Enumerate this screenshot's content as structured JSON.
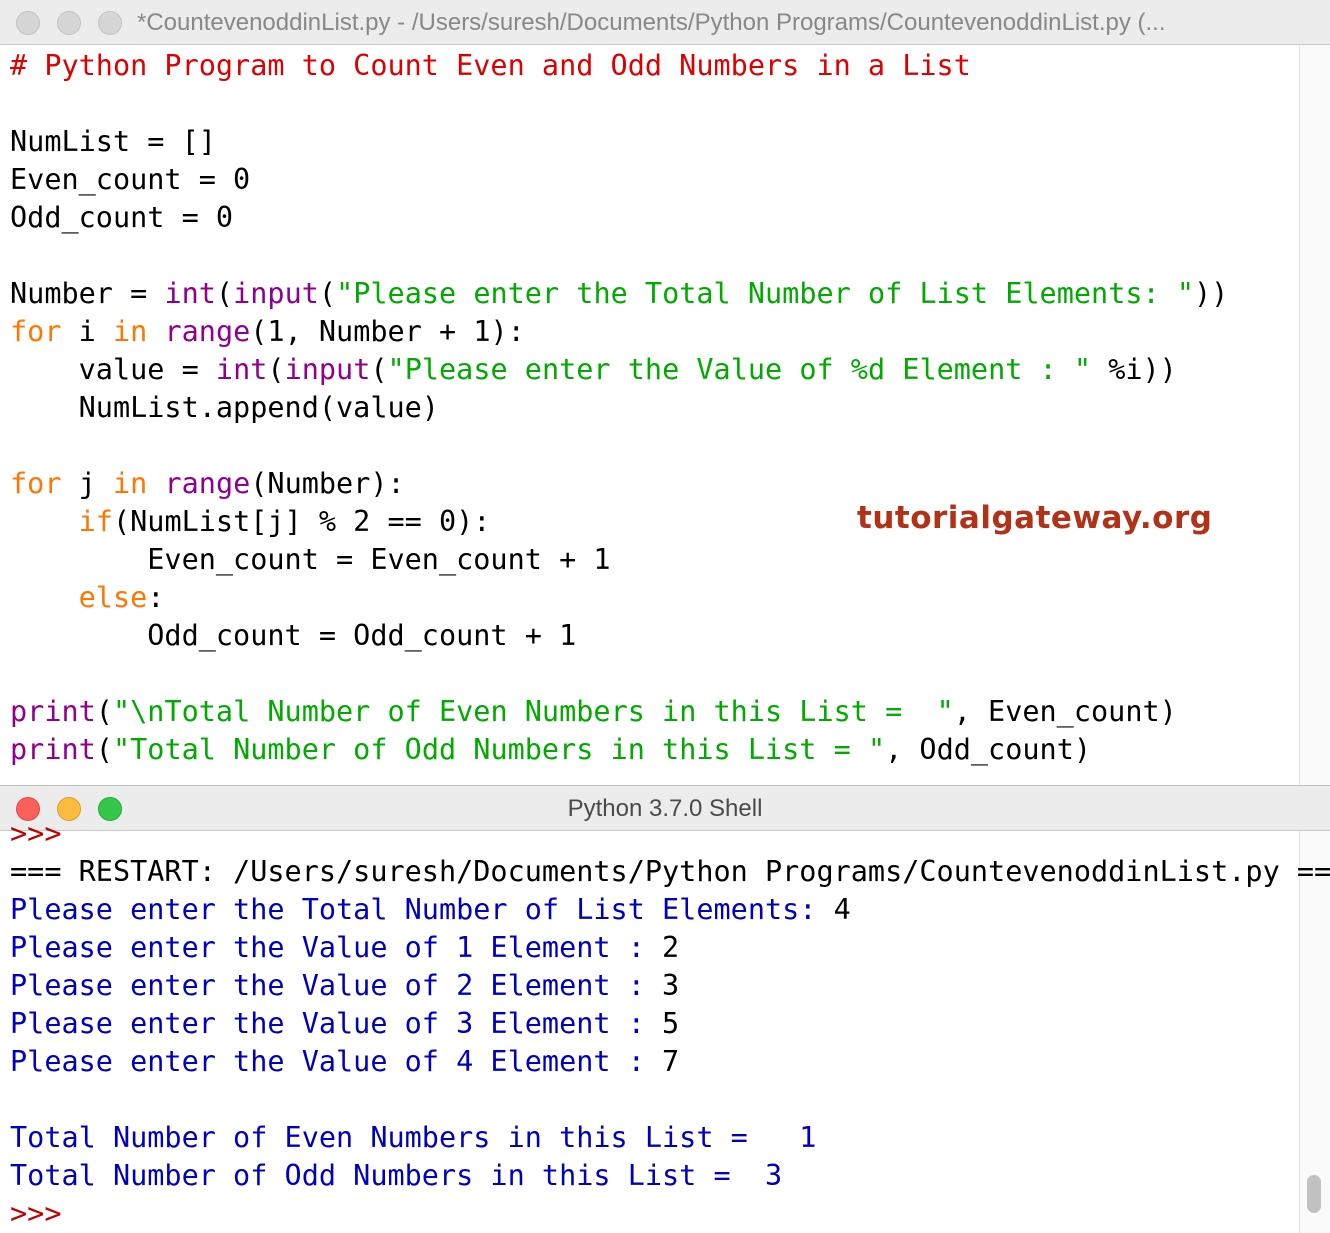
{
  "editor": {
    "title": "*CountevenoddinList.py - /Users/suresh/Documents/Python Programs/CountevenoddinList.py (...",
    "lines": [
      [
        {
          "c": "cm",
          "t": "# Python Program to Count Even and Odd Numbers in a List"
        }
      ],
      [],
      [
        {
          "c": "",
          "t": "NumList = []"
        }
      ],
      [
        {
          "c": "",
          "t": "Even_count = 0"
        }
      ],
      [
        {
          "c": "",
          "t": "Odd_count = 0"
        }
      ],
      [],
      [
        {
          "c": "",
          "t": "Number = "
        },
        {
          "c": "bi",
          "t": "int"
        },
        {
          "c": "",
          "t": "("
        },
        {
          "c": "bi",
          "t": "input"
        },
        {
          "c": "",
          "t": "("
        },
        {
          "c": "st",
          "t": "\"Please enter the Total Number of List Elements: \""
        },
        {
          "c": "",
          "t": "))"
        }
      ],
      [
        {
          "c": "kw",
          "t": "for"
        },
        {
          "c": "",
          "t": " i "
        },
        {
          "c": "kw",
          "t": "in"
        },
        {
          "c": "",
          "t": " "
        },
        {
          "c": "bi",
          "t": "range"
        },
        {
          "c": "",
          "t": "(1, Number + 1):"
        }
      ],
      [
        {
          "c": "",
          "t": "    value = "
        },
        {
          "c": "bi",
          "t": "int"
        },
        {
          "c": "",
          "t": "("
        },
        {
          "c": "bi",
          "t": "input"
        },
        {
          "c": "",
          "t": "("
        },
        {
          "c": "st",
          "t": "\"Please enter the Value of %d Element : \""
        },
        {
          "c": "",
          "t": " %i))"
        }
      ],
      [
        {
          "c": "",
          "t": "    NumList.append(value)"
        }
      ],
      [],
      [
        {
          "c": "kw",
          "t": "for"
        },
        {
          "c": "",
          "t": " j "
        },
        {
          "c": "kw",
          "t": "in"
        },
        {
          "c": "",
          "t": " "
        },
        {
          "c": "bi",
          "t": "range"
        },
        {
          "c": "",
          "t": "(Number):"
        }
      ],
      [
        {
          "c": "",
          "t": "    "
        },
        {
          "c": "kw",
          "t": "if"
        },
        {
          "c": "",
          "t": "(NumList[j] % 2 == 0):"
        }
      ],
      [
        {
          "c": "",
          "t": "        Even_count = Even_count + 1"
        }
      ],
      [
        {
          "c": "",
          "t": "    "
        },
        {
          "c": "kw",
          "t": "else"
        },
        {
          "c": "",
          "t": ":"
        }
      ],
      [
        {
          "c": "",
          "t": "        Odd_count = Odd_count + 1"
        }
      ],
      [],
      [
        {
          "c": "bi",
          "t": "print"
        },
        {
          "c": "",
          "t": "("
        },
        {
          "c": "st",
          "t": "\"\\nTotal Number of Even Numbers in this List =  \""
        },
        {
          "c": "",
          "t": ", Even_count)"
        }
      ],
      [
        {
          "c": "bi",
          "t": "print"
        },
        {
          "c": "",
          "t": "("
        },
        {
          "c": "st",
          "t": "\"Total Number of Odd Numbers in this List = \""
        },
        {
          "c": "",
          "t": ", Odd_count)"
        }
      ]
    ]
  },
  "watermark": "tutorialgateway.org",
  "shell": {
    "title": "Python 3.7.0 Shell",
    "lines": [
      [
        {
          "c": "prompt",
          "t": ">>>"
        }
      ],
      [
        {
          "c": "",
          "t": "=== RESTART: /Users/suresh/Documents/Python Programs/CountevenoddinList.py ==="
        }
      ],
      [
        {
          "c": "out",
          "t": "Please enter the Total Number of List Elements: "
        },
        {
          "c": "",
          "t": "4"
        }
      ],
      [
        {
          "c": "out",
          "t": "Please enter the Value of 1 Element : "
        },
        {
          "c": "",
          "t": "2"
        }
      ],
      [
        {
          "c": "out",
          "t": "Please enter the Value of 2 Element : "
        },
        {
          "c": "",
          "t": "3"
        }
      ],
      [
        {
          "c": "out",
          "t": "Please enter the Value of 3 Element : "
        },
        {
          "c": "",
          "t": "5"
        }
      ],
      [
        {
          "c": "out",
          "t": "Please enter the Value of 4 Element : "
        },
        {
          "c": "",
          "t": "7"
        }
      ],
      [],
      [
        {
          "c": "out",
          "t": "Total Number of Even Numbers in this List =   1"
        }
      ],
      [
        {
          "c": "out",
          "t": "Total Number of Odd Numbers in this List =  3"
        }
      ],
      [
        {
          "c": "prompt",
          "t": ">>>"
        }
      ]
    ]
  },
  "colors": {
    "comment": "#dd0000",
    "keyword": "#ff7700",
    "builtin": "#900090",
    "string": "#00aa00",
    "output": "#0000c0",
    "prompt": "#c00000",
    "watermark": "#b23218"
  },
  "icons": [
    "close-light-icon",
    "minimize-light-icon",
    "zoom-light-icon"
  ]
}
